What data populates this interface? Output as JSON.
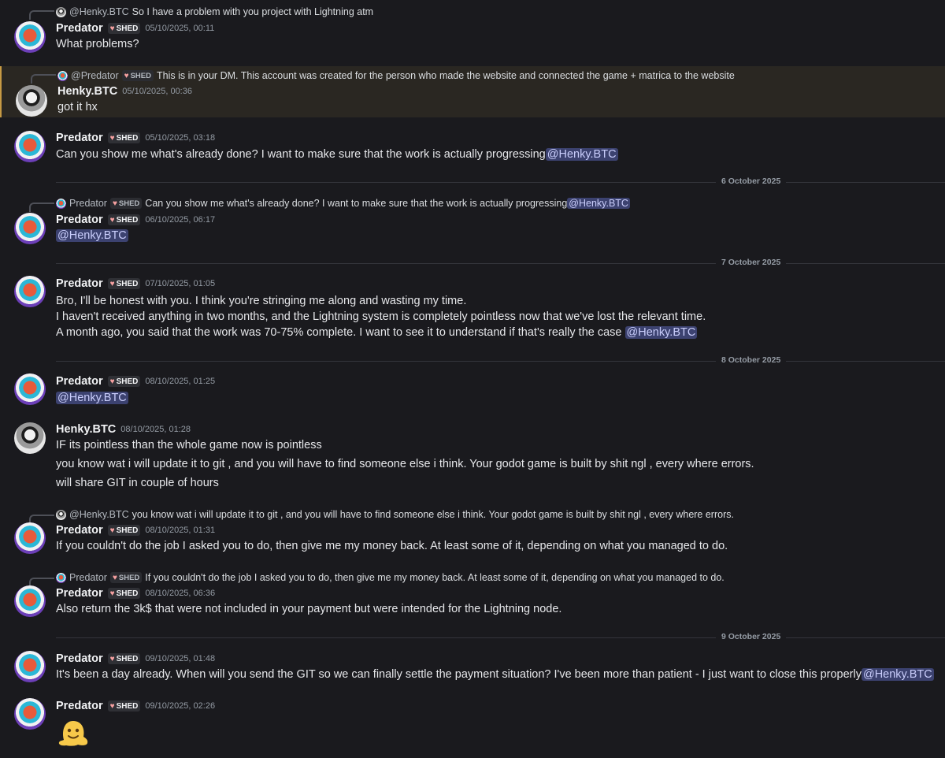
{
  "users": {
    "predator": "Predator",
    "henky": "Henky.BTC"
  },
  "tag": {
    "label": "SHED",
    "heart_icon": "heart-icon"
  },
  "colors": {
    "mention_bg": "#3c4270",
    "highlight_bar": "#c69a44"
  },
  "m0": {
    "reply_name": "@Henky.BTC",
    "reply_text": "So I have a problem with you project with Lightning atm",
    "ts": "05/10/2025, 00:11",
    "text": "What problems?"
  },
  "m1": {
    "reply_name": "@Predator",
    "reply_text": "This is in your DM. This account was created for the person who made the website and connected the game + matrica to the website",
    "ts": "05/10/2025, 00:36",
    "text": "got it hx"
  },
  "m2": {
    "ts": "05/10/2025, 03:18",
    "text": "Can you show me what's already done? I want to make sure that the work is actually progressing",
    "mention": "@Henky.BTC"
  },
  "d1": "6 October 2025",
  "m3": {
    "reply_name": "Predator",
    "reply_text": "Can you show me what's already done? I want to make sure that the work is actually progressing",
    "reply_mention": "@Henky.BTC",
    "ts": "06/10/2025, 06:17",
    "mention": "@Henky.BTC"
  },
  "d2": "7 October 2025",
  "m4": {
    "ts": "07/10/2025, 01:05",
    "l1": "Bro, I'll be honest with you. I think you're stringing me along and wasting my time.",
    "l2": "I haven't received anything in two months, and the Lightning system is completely pointless now that we've lost the relevant time.",
    "l3": "A month ago, you said that the work was 70-75% complete. I want to see it to understand if that's really the case",
    "mention": "@Henky.BTC"
  },
  "d3": "8 October 2025",
  "m5": {
    "ts": "08/10/2025, 01:25",
    "mention": "@Henky.BTC"
  },
  "m6": {
    "ts": "08/10/2025, 01:28",
    "l1": "IF its pointless than the whole game now is pointless",
    "l2": "you know wat i will update it to git , and you will have to find someone else i think. Your godot game is built by shit ngl , every where errors.",
    "l3": "will share GIT in couple of hours"
  },
  "m7": {
    "reply_name": "@Henky.BTC",
    "reply_text": "you know wat i will update it to git , and you will have to find someone else i think. Your godot game is built by shit ngl , every where errors.",
    "ts": "08/10/2025, 01:31",
    "text": "If you couldn't do the job I asked you to do, then give me my money back. At least some of it, depending on what you managed to do."
  },
  "m8": {
    "reply_name": "Predator",
    "reply_text": "If you couldn't do the job I asked you to do, then give me my money back. At least some of it, depending on what you managed to do.",
    "ts": "08/10/2025, 06:36",
    "text": "Also return the 3k$ that were not included in your payment but were intended for the Lightning node."
  },
  "d4": "9 October 2025",
  "m9": {
    "ts": "09/10/2025, 01:48",
    "text": "It's been a day already. When will you send the GIT so we can finally settle the payment situation? I've been more than patient - I just want to close this properly",
    "mention": "@Henky.BTC"
  },
  "m10": {
    "ts": "09/10/2025, 02:26",
    "emoji": "melting-face-emoji"
  }
}
